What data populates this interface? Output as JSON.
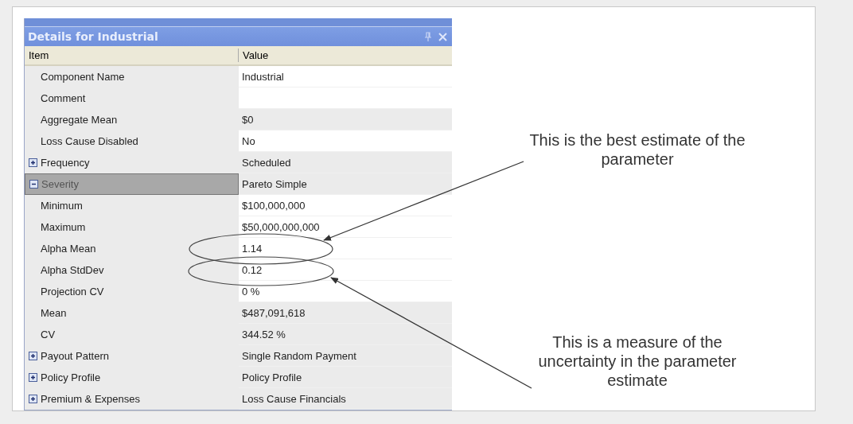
{
  "panel": {
    "title": "Details for Industrial"
  },
  "columns": [
    "Item",
    "Value"
  ],
  "rows": [
    {
      "item": "Component Name",
      "value": "Industrial",
      "readonly": false,
      "selected": false
    },
    {
      "item": "Comment",
      "readonly": false,
      "selected": false
    },
    {
      "item": "Aggregate Mean",
      "value": "$0",
      "readonly": true,
      "selected": false
    },
    {
      "item": "Loss Cause Disabled",
      "value": "No",
      "readonly": false,
      "selected": false
    },
    {
      "item": "Frequency",
      "value": "Scheduled",
      "readonly": true,
      "selected": false,
      "expanded": false
    },
    {
      "item": "Severity",
      "value": "Pareto Simple",
      "readonly": true,
      "selected": true,
      "expanded": true,
      "children": [
        {
          "item": "Minimum",
          "value": "$100,000,000",
          "readonly": false,
          "selected": false
        },
        {
          "item": "Maximum",
          "value": "$50,000,000,000",
          "readonly": false,
          "selected": false
        },
        {
          "item": "Alpha Mean",
          "value": "1.14",
          "readonly": false,
          "selected": false
        },
        {
          "item": "Alpha StdDev",
          "value": "0.12",
          "readonly": false,
          "selected": false
        },
        {
          "item": "Projection CV",
          "value": "0 %",
          "readonly": false,
          "selected": false
        },
        {
          "item": "Mean",
          "value": "$487,091,618",
          "readonly": true,
          "selected": false
        },
        {
          "item": "CV",
          "value": "344.52 %",
          "readonly": true,
          "selected": false
        }
      ]
    },
    {
      "item": "Payout Pattern",
      "value": "Single Random Payment",
      "readonly": true,
      "selected": false,
      "expanded": false
    },
    {
      "item": "Policy Profile",
      "value": "Policy Profile",
      "readonly": true,
      "selected": false,
      "expanded": false
    },
    {
      "item": "Premium & Expenses",
      "value": "Loss Cause Financials",
      "readonly": true,
      "selected": false,
      "expanded": false
    }
  ],
  "annotations": [
    "This is the best estimate of the parameter",
    "This is a measure of the uncertainty in the parameter estimate"
  ]
}
